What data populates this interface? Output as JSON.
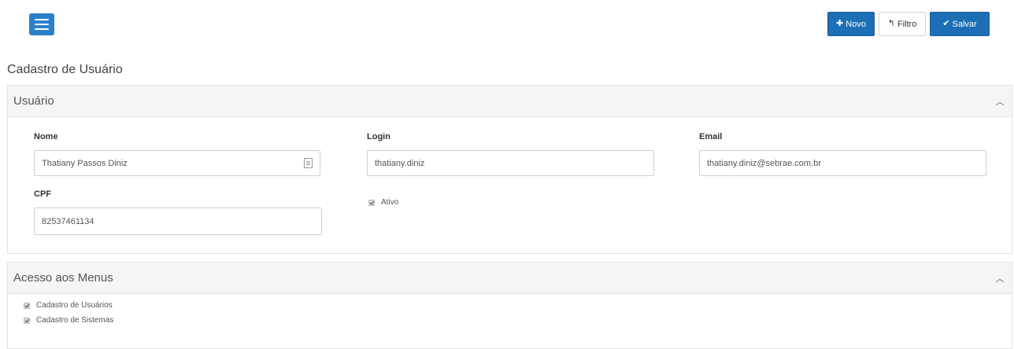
{
  "topbar": {
    "buttons": {
      "novo": {
        "label": "Novo",
        "icon": "plus-icon"
      },
      "filtro": {
        "label": "Filtro",
        "icon": "reply-icon"
      },
      "salvar": {
        "label": "Salvar",
        "icon": "check-icon"
      }
    },
    "colors": {
      "primary": "#1d6fb5",
      "menu_button": "#2a80c9"
    }
  },
  "page_title": "Cadastro de Usuário",
  "usuario_panel": {
    "title": "Usuário",
    "fields": {
      "nome": {
        "label": "Nome",
        "value": "Thatiany Passos Diniz",
        "icon": "id-card-icon"
      },
      "login": {
        "label": "Login",
        "value": "thatiany.diniz"
      },
      "email": {
        "label": "Email",
        "value": "thatiany.diniz@sebrae.com.br"
      },
      "cpf": {
        "label": "CPF",
        "value": "82537461134"
      }
    },
    "ativo": {
      "label": "Ativo",
      "checked": true
    }
  },
  "menus_panel": {
    "title": "Acesso aos Menus",
    "items": [
      {
        "label": "Cadastro de Usuários",
        "checked": true
      },
      {
        "label": "Cadastro de Sistemas",
        "checked": true
      }
    ]
  }
}
